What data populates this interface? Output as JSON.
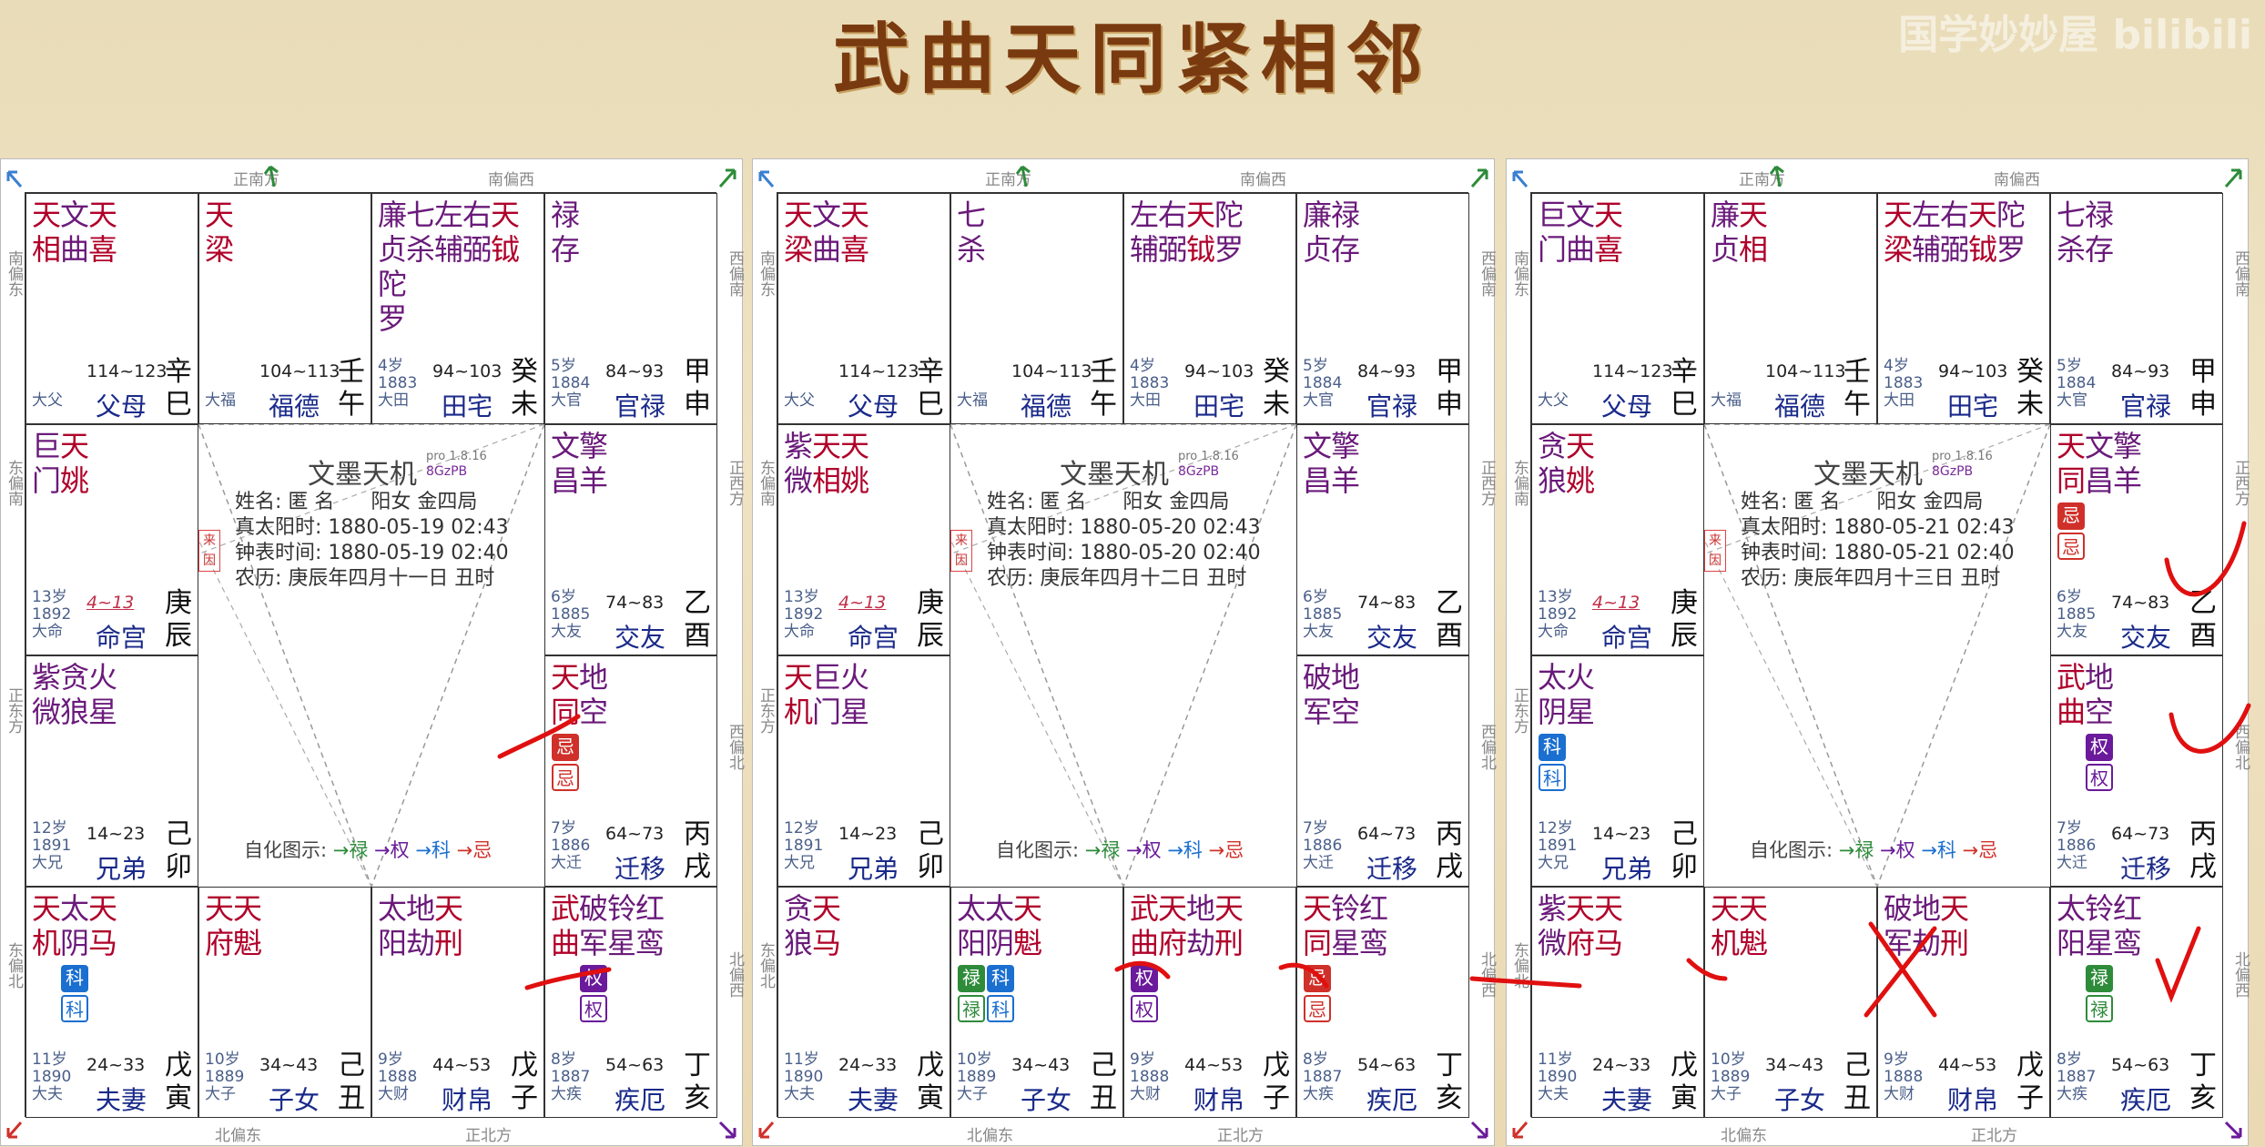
{
  "title": "武曲天同紧相邻",
  "watermark": "国学妙妙屋 bilibili",
  "colors": {
    "lu": "#2e8b3a",
    "quan": "#6a1a9a",
    "ke": "#1a6fd0",
    "ji": "#d0302a",
    "star_red": "#b0002a",
    "star_purple": "#6a1a7a",
    "palace_blue": "#1a2a8a"
  },
  "directions": {
    "top_1": "正南方",
    "top_2": "南偏西",
    "left_1": "南偏东",
    "left_2": "东偏南",
    "left_3": "正东方",
    "left_4": "东偏北",
    "right_1": "西偏南",
    "right_2": "正西方",
    "right_3": "西偏北",
    "right_4": "北偏西",
    "bottom_1": "北偏东",
    "bottom_2": "正北方"
  },
  "charts": [
    {
      "info": {
        "name": "姓名: 匿 名",
        "gender": "阳女 金四局",
        "solar": "真太阳时: 1880-05-19 02:43",
        "clock": "钟表时间: 1880-05-19 02:40",
        "lunar": "农历: 庚辰年四月十一日 丑时"
      },
      "cells": [
        {
          "stars": [
            [
              "天",
              "相"
            ],
            [
              "文",
              "曲"
            ],
            [
              "天",
              "喜"
            ]
          ],
          "age": "",
          "year": "",
          "big": "大父",
          "range": "114~123",
          "palace": "父母",
          "gz": [
            "辛",
            "巳"
          ],
          "hua": []
        },
        {
          "stars": [
            [
              "天",
              "梁"
            ]
          ],
          "age": "",
          "year": "",
          "big": "大福",
          "range": "104~113",
          "palace": "福德",
          "gz": [
            "壬",
            "午"
          ],
          "hua": []
        },
        {
          "stars": [
            [
              "廉",
              "贞"
            ],
            [
              "七",
              "杀"
            ],
            [
              "左",
              "辅"
            ],
            [
              "右",
              "弼"
            ],
            [
              "天",
              "钺"
            ],
            [
              "陀",
              "罗"
            ]
          ],
          "age": "4岁",
          "year": "1883",
          "big": "大田",
          "range": "94~103",
          "palace": "田宅",
          "gz": [
            "癸",
            "未"
          ],
          "hua": []
        },
        {
          "stars": [
            [
              "禄",
              "存"
            ]
          ],
          "age": "5岁",
          "year": "1884",
          "big": "大官",
          "range": "84~93",
          "palace": "官禄",
          "gz": [
            "甲",
            "申"
          ],
          "hua": []
        },
        {
          "stars": [
            [
              "巨",
              "门"
            ],
            [
              "天",
              "姚"
            ]
          ],
          "age": "13岁",
          "year": "1892",
          "big": "大命",
          "range": "4~13",
          "palace": "命宫",
          "gz": [
            "庚",
            "辰"
          ],
          "hua": []
        },
        {
          "stars": [
            [
              "文",
              "昌"
            ],
            [
              "擎",
              "羊"
            ]
          ],
          "age": "6岁",
          "year": "1885",
          "big": "大友",
          "range": "74~83",
          "palace": "交友",
          "gz": [
            "乙",
            "酉"
          ],
          "hua": []
        },
        {
          "stars": [
            [
              "紫",
              "微"
            ],
            [
              "贪",
              "狼"
            ],
            [
              "火",
              "星"
            ]
          ],
          "age": "12岁",
          "year": "1891",
          "big": "大兄",
          "range": "14~23",
          "palace": "兄弟",
          "gz": [
            "己",
            "卯"
          ],
          "hua": []
        },
        {
          "stars": [
            [
              "天",
              "同"
            ],
            [
              "地",
              "空"
            ]
          ],
          "age": "7岁",
          "year": "1886",
          "big": "大迁",
          "range": "64~73",
          "palace": "迁移",
          "gz": [
            "丙",
            "戌"
          ],
          "hua": [
            [],
            [],
            [],
            []
          ]
        },
        {
          "stars": [
            [
              "天",
              "机"
            ],
            [
              "太",
              "阴"
            ],
            [
              "天",
              "马"
            ]
          ],
          "age": "11岁",
          "year": "1890",
          "big": "大夫",
          "range": "24~33",
          "palace": "夫妻",
          "gz": [
            "戊",
            "寅"
          ],
          "hua": []
        },
        {
          "stars": [
            [
              "天",
              "府"
            ],
            [
              "天",
              "魁"
            ]
          ],
          "age": "10岁",
          "year": "1889",
          "big": "大子",
          "range": "34~43",
          "palace": "子女",
          "gz": [
            "己",
            "丑"
          ],
          "hua": []
        },
        {
          "stars": [
            [
              "太",
              "阳"
            ],
            [
              "地",
              "劫"
            ],
            [
              "天",
              "刑"
            ]
          ],
          "age": "9岁",
          "year": "1888",
          "big": "大财",
          "range": "44~53",
          "palace": "财帛",
          "gz": [
            "戊",
            "子"
          ],
          "hua": []
        },
        {
          "stars": [
            [
              "武",
              "曲"
            ],
            [
              "破",
              "军"
            ],
            [
              "铃",
              "星"
            ],
            [
              "红",
              "鸾"
            ]
          ],
          "age": "8岁",
          "year": "1887",
          "big": "大疾",
          "range": "54~63",
          "palace": "疾厄",
          "gz": [
            "丁",
            "亥"
          ],
          "hua": []
        }
      ]
    },
    {
      "info": {
        "name": "姓名: 匿 名",
        "gender": "阳女 金四局",
        "solar": "真太阳时: 1880-05-20 02:43",
        "clock": "钟表时间: 1880-05-20 02:40",
        "lunar": "农历: 庚辰年四月十二日 丑时"
      },
      "cells": [
        {
          "stars": [
            [
              "天",
              "梁"
            ],
            [
              "文",
              "曲"
            ],
            [
              "天",
              "喜"
            ]
          ],
          "age": "",
          "year": "",
          "big": "大父",
          "range": "114~123",
          "palace": "父母",
          "gz": [
            "辛",
            "巳"
          ]
        },
        {
          "stars": [
            [
              "七",
              "杀"
            ]
          ],
          "age": "",
          "year": "",
          "big": "大福",
          "range": "104~113",
          "palace": "福德",
          "gz": [
            "壬",
            "午"
          ]
        },
        {
          "stars": [
            [
              "左",
              "辅"
            ],
            [
              "右",
              "弼"
            ],
            [
              "天",
              "钺"
            ],
            [
              "陀",
              "罗"
            ]
          ],
          "age": "4岁",
          "year": "1883",
          "big": "大田",
          "range": "94~103",
          "palace": "田宅",
          "gz": [
            "癸",
            "未"
          ]
        },
        {
          "stars": [
            [
              "廉",
              "贞"
            ],
            [
              "禄",
              "存"
            ]
          ],
          "age": "5岁",
          "year": "1884",
          "big": "大官",
          "range": "84~93",
          "palace": "官禄",
          "gz": [
            "甲",
            "申"
          ]
        },
        {
          "stars": [
            [
              "紫",
              "微"
            ],
            [
              "天",
              "相"
            ],
            [
              "天",
              "姚"
            ]
          ],
          "age": "13岁",
          "year": "1892",
          "big": "大命",
          "range": "4~13",
          "palace": "命宫",
          "gz": [
            "庚",
            "辰"
          ]
        },
        {
          "stars": [
            [
              "文",
              "昌"
            ],
            [
              "擎",
              "羊"
            ]
          ],
          "age": "6岁",
          "year": "1885",
          "big": "大友",
          "range": "74~83",
          "palace": "交友",
          "gz": [
            "乙",
            "酉"
          ]
        },
        {
          "stars": [
            [
              "天",
              "机"
            ],
            [
              "巨",
              "门"
            ],
            [
              "火",
              "星"
            ]
          ],
          "age": "12岁",
          "year": "1891",
          "big": "大兄",
          "range": "14~23",
          "palace": "兄弟",
          "gz": [
            "己",
            "卯"
          ]
        },
        {
          "stars": [
            [
              "破",
              "军"
            ],
            [
              "地",
              "空"
            ]
          ],
          "age": "7岁",
          "year": "1886",
          "big": "大迁",
          "range": "64~73",
          "palace": "迁移",
          "gz": [
            "丙",
            "戌"
          ]
        },
        {
          "stars": [
            [
              "贪",
              "狼"
            ],
            [
              "天",
              "马"
            ]
          ],
          "age": "11岁",
          "year": "1890",
          "big": "大夫",
          "range": "24~33",
          "palace": "夫妻",
          "gz": [
            "戊",
            "寅"
          ]
        },
        {
          "stars": [
            [
              "太",
              "阳"
            ],
            [
              "太",
              "阴"
            ],
            [
              "天",
              "魁"
            ]
          ],
          "age": "10岁",
          "year": "1889",
          "big": "大子",
          "range": "34~43",
          "palace": "子女",
          "gz": [
            "己",
            "丑"
          ]
        },
        {
          "stars": [
            [
              "武",
              "曲"
            ],
            [
              "天",
              "府"
            ],
            [
              "地",
              "劫"
            ],
            [
              "天",
              "刑"
            ]
          ],
          "age": "9岁",
          "year": "1888",
          "big": "大财",
          "range": "44~53",
          "palace": "财帛",
          "gz": [
            "戊",
            "子"
          ]
        },
        {
          "stars": [
            [
              "天",
              "同"
            ],
            [
              "铃",
              "星"
            ],
            [
              "红",
              "鸾"
            ]
          ],
          "age": "8岁",
          "year": "1887",
          "big": "大疾",
          "range": "54~63",
          "palace": "疾厄",
          "gz": [
            "丁",
            "亥"
          ]
        }
      ]
    },
    {
      "info": {
        "name": "姓名: 匿 名",
        "gender": "阳女 金四局",
        "solar": "真太阳时: 1880-05-21 02:43",
        "clock": "钟表时间: 1880-05-21 02:40",
        "lunar": "农历: 庚辰年四月十三日 丑时"
      },
      "cells": [
        {
          "stars": [
            [
              "巨",
              "门"
            ],
            [
              "文",
              "曲"
            ],
            [
              "天",
              "喜"
            ]
          ],
          "age": "",
          "year": "",
          "big": "大父",
          "range": "114~123",
          "palace": "父母",
          "gz": [
            "辛",
            "巳"
          ]
        },
        {
          "stars": [
            [
              "廉",
              "贞"
            ],
            [
              "天",
              "相"
            ]
          ],
          "age": "",
          "year": "",
          "big": "大福",
          "range": "104~113",
          "palace": "福德",
          "gz": [
            "壬",
            "午"
          ]
        },
        {
          "stars": [
            [
              "天",
              "梁"
            ],
            [
              "左",
              "辅"
            ],
            [
              "右",
              "弼"
            ],
            [
              "天",
              "钺"
            ],
            [
              "陀",
              "罗"
            ]
          ],
          "age": "4岁",
          "year": "1883",
          "big": "大田",
          "range": "94~103",
          "palace": "田宅",
          "gz": [
            "癸",
            "未"
          ]
        },
        {
          "stars": [
            [
              "七",
              "杀"
            ],
            [
              "禄",
              "存"
            ]
          ],
          "age": "5岁",
          "year": "1884",
          "big": "大官",
          "range": "84~93",
          "palace": "官禄",
          "gz": [
            "甲",
            "申"
          ]
        },
        {
          "stars": [
            [
              "贪",
              "狼"
            ],
            [
              "天",
              "姚"
            ]
          ],
          "age": "13岁",
          "year": "1892",
          "big": "大命",
          "range": "4~13",
          "palace": "命宫",
          "gz": [
            "庚",
            "辰"
          ]
        },
        {
          "stars": [
            [
              "天",
              "同"
            ],
            [
              "文",
              "昌"
            ],
            [
              "擎",
              "羊"
            ]
          ],
          "age": "6岁",
          "year": "1885",
          "big": "大友",
          "range": "74~83",
          "palace": "交友",
          "gz": [
            "乙",
            "酉"
          ]
        },
        {
          "stars": [
            [
              "太",
              "阴"
            ],
            [
              "火",
              "星"
            ]
          ],
          "age": "12岁",
          "year": "1891",
          "big": "大兄",
          "range": "14~23",
          "palace": "兄弟",
          "gz": [
            "己",
            "卯"
          ]
        },
        {
          "stars": [
            [
              "武",
              "曲"
            ],
            [
              "地",
              "空"
            ]
          ],
          "age": "7岁",
          "year": "1886",
          "big": "大迁",
          "range": "64~73",
          "palace": "迁移",
          "gz": [
            "丙",
            "戌"
          ]
        },
        {
          "stars": [
            [
              "紫",
              "微"
            ],
            [
              "天",
              "府"
            ],
            [
              "天",
              "马"
            ]
          ],
          "age": "11岁",
          "year": "1890",
          "big": "大夫",
          "range": "24~33",
          "palace": "夫妻",
          "gz": [
            "戊",
            "寅"
          ]
        },
        {
          "stars": [
            [
              "天",
              "机"
            ],
            [
              "天",
              "魁"
            ]
          ],
          "age": "10岁",
          "year": "1889",
          "big": "大子",
          "range": "34~43",
          "palace": "子女",
          "gz": [
            "己",
            "丑"
          ]
        },
        {
          "stars": [
            [
              "破",
              "军"
            ],
            [
              "地",
              "劫"
            ],
            [
              "天",
              "刑"
            ]
          ],
          "age": "9岁",
          "year": "1888",
          "big": "大财",
          "range": "44~53",
          "palace": "财帛",
          "gz": [
            "戊",
            "子"
          ]
        },
        {
          "stars": [
            [
              "太",
              "阳"
            ],
            [
              "铃",
              "星"
            ],
            [
              "红",
              "鸾"
            ]
          ],
          "age": "8岁",
          "year": "1887",
          "big": "大疾",
          "range": "54~63",
          "palace": "疾厄",
          "gz": [
            "丁",
            "亥"
          ]
        }
      ]
    }
  ],
  "hua_labels": {
    "lu": "禄",
    "quan": "权",
    "ke": "科",
    "ji": "忌"
  },
  "center": {
    "brand": "文墨天机",
    "version": "pro 1.8.16",
    "code": "8GzPB",
    "laiyin": "来因",
    "legend_prefix": "自化图示:",
    "legend_lu": "→禄",
    "legend_quan": "→权",
    "legend_ke": "→科",
    "legend_ji": "→忌"
  }
}
